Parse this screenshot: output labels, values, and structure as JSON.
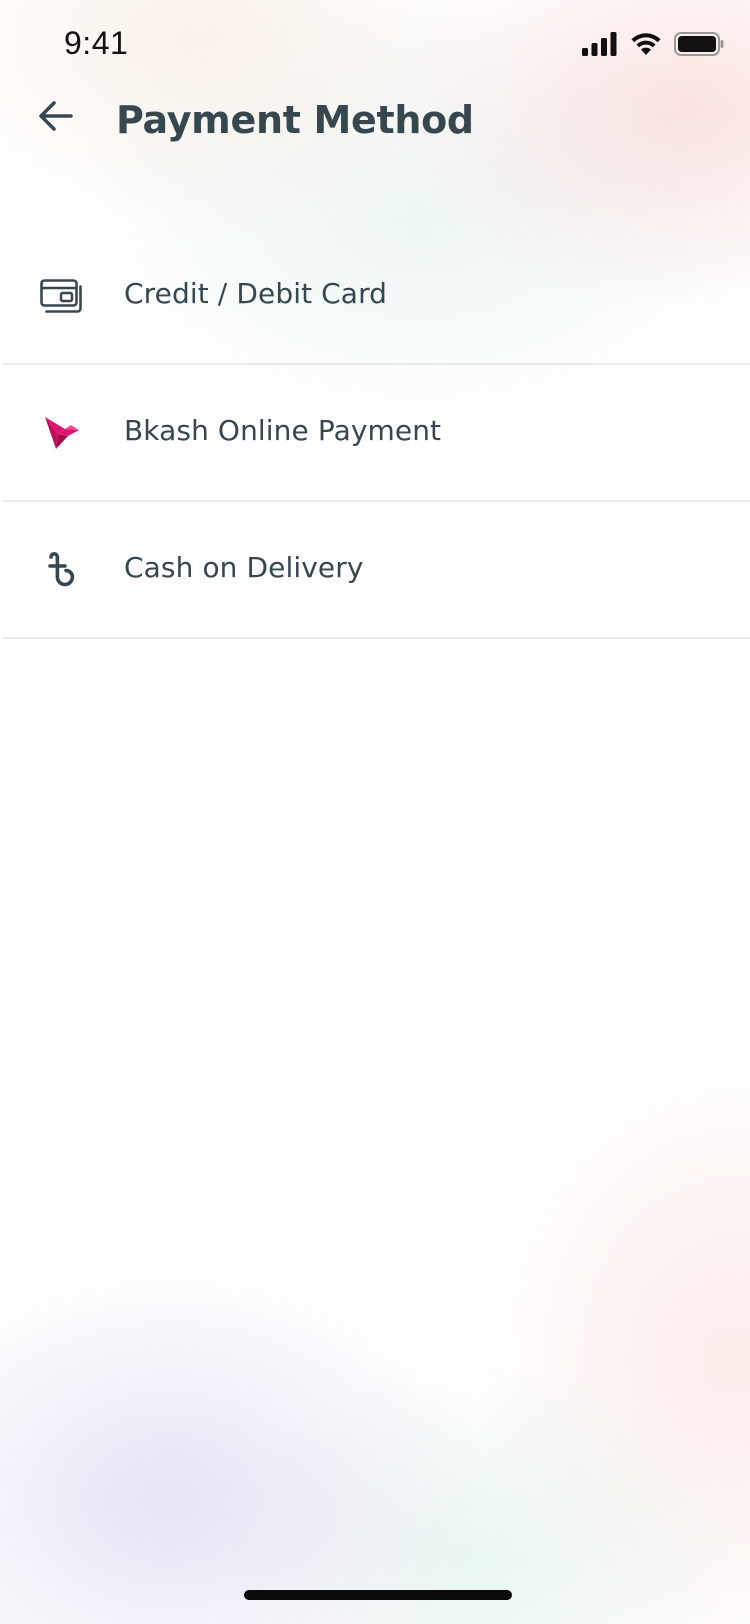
{
  "status_bar": {
    "time": "9:41",
    "icons": [
      "signal-icon",
      "wifi-icon",
      "battery-icon"
    ]
  },
  "header": {
    "back_icon": "arrow-left-icon",
    "title": "Payment Method"
  },
  "payment_methods": [
    {
      "label": "Credit / Debit Card",
      "icon": "credit-card-icon"
    },
    {
      "label": "Bkash Online Payment",
      "icon": "bkash-bird-icon",
      "icon_color": "#e2136e"
    },
    {
      "label": "Cash on Delivery",
      "icon": "taka-icon"
    }
  ],
  "colors": {
    "text_primary": "#37474f",
    "divider": "#e9ecec",
    "bkash_brand": "#e2136e"
  }
}
